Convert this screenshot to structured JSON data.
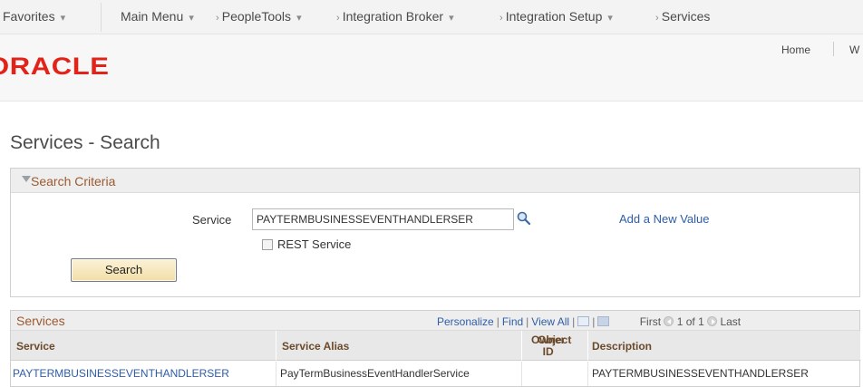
{
  "topnav": {
    "favorites": "Favorites",
    "main_menu": "Main Menu",
    "crumbs": [
      "PeopleTools",
      "Integration Broker",
      "Integration Setup",
      "Services"
    ]
  },
  "header": {
    "logo": "ORACLE",
    "home_link": "Home",
    "partial_link": "W"
  },
  "page": {
    "title": "Services - Search"
  },
  "search": {
    "section_title": "Search Criteria",
    "service_label": "Service",
    "service_value": "PAYTERMBUSINESSEVENTHANDLERSER",
    "add_link": "Add a New Value",
    "rest_checkbox_label": "REST Service",
    "rest_checked": false,
    "search_button": "Search"
  },
  "results": {
    "title": "Services",
    "personalize": "Personalize",
    "find": "Find",
    "view_all": "View All",
    "first": "First",
    "range": "1 of 1",
    "last": "Last",
    "columns": [
      "Service",
      "Service Alias",
      "Object Owner ID",
      "Description"
    ],
    "owner_col_line1": "Object",
    "owner_col_line2": "Owner ID",
    "rows": [
      {
        "service": "PAYTERMBUSINESSEVENTHANDLERSER",
        "alias": "PayTermBusinessEventHandlerService",
        "owner": "",
        "description": "PAYTERMBUSINESSEVENTHANDLERSER"
      }
    ]
  },
  "colors": {
    "oracle_red": "#e2231a",
    "link_blue": "#2f5da8",
    "section_brown": "#9c5a2f"
  },
  "icons": [
    "chevron-down-icon",
    "lookup-magnifier-icon",
    "checkbox-icon",
    "zoom-grid-icon",
    "download-grid-icon",
    "previous-circle-icon",
    "next-circle-icon",
    "collapse-triangle-icon"
  ]
}
